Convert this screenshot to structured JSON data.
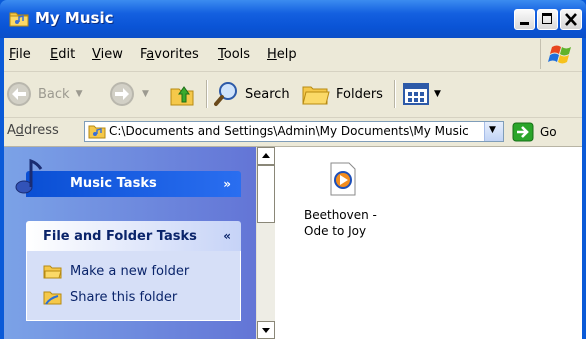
{
  "window": {
    "title": "My Music"
  },
  "menu": [
    {
      "label": "File",
      "key": "F",
      "rest": "ile"
    },
    {
      "label": "Edit",
      "key": "E",
      "rest": "dit"
    },
    {
      "label": "View",
      "key": "V",
      "rest": "iew"
    },
    {
      "label": "Favorites",
      "key": "a",
      "pre": "F",
      "rest": "vorites"
    },
    {
      "label": "Tools",
      "key": "T",
      "rest": "ools"
    },
    {
      "label": "Help",
      "key": "H",
      "rest": "elp"
    }
  ],
  "toolbar": {
    "back_label": "Back",
    "search_label": "Search",
    "folders_label": "Folders"
  },
  "address": {
    "label_pre": "A",
    "label_key": "d",
    "label_rest": "dress",
    "value": "C:\\Documents and Settings\\Admin\\My Documents\\My Music",
    "go_label": "Go"
  },
  "tasks": {
    "music_title": "Music Tasks",
    "file_folder_title": "File and Folder Tasks",
    "links": [
      "Make a new folder",
      "Share this folder"
    ]
  },
  "files": [
    {
      "name": "Beethoven -\nOde to Joy",
      "icon": "media-file-icon"
    }
  ],
  "colors": {
    "titlebar": "#0a54d6",
    "chrome": "#ece9d8",
    "taskpane": "#7ba2e7",
    "go_green": "#2aa52a"
  }
}
